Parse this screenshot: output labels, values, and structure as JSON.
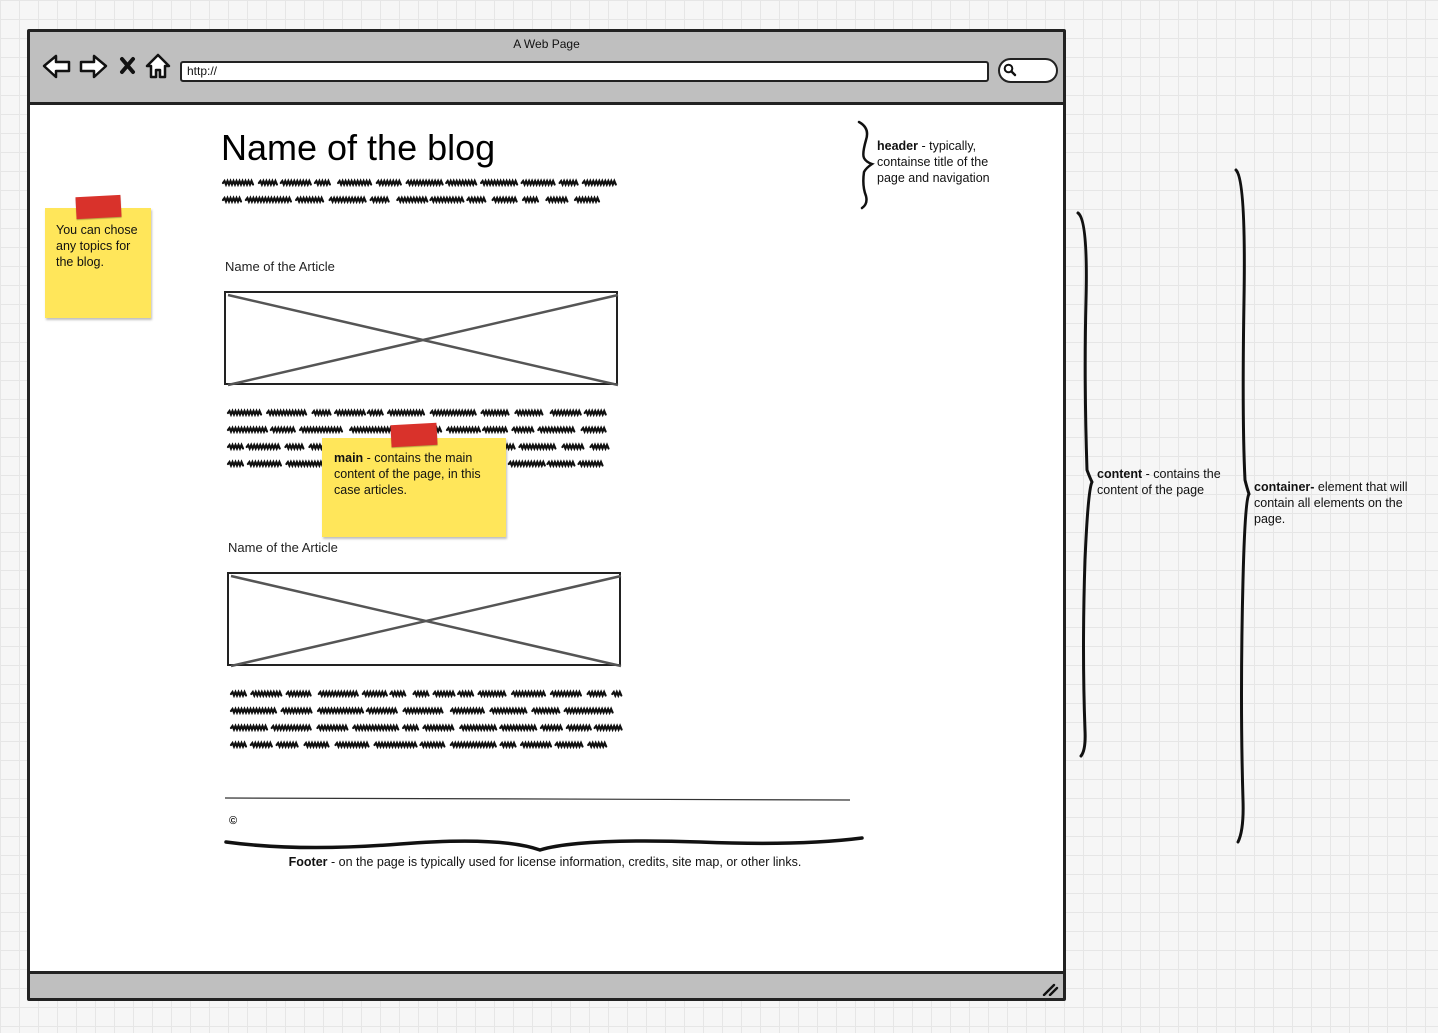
{
  "window": {
    "title": "A Web Page",
    "url": "http://"
  },
  "blog": {
    "title": "Name of the blog"
  },
  "articles": [
    {
      "title": "Name of the Article"
    },
    {
      "title": "Name of the Article"
    }
  ],
  "footer": {
    "copyright_symbol": "©"
  },
  "notes": {
    "topics": "You can chose any topics for the blog.",
    "main_term": "main",
    "main_text": " - contains the main content of the page, in this case articles."
  },
  "annotations": {
    "header_term": "header",
    "header_text": " - typically, containse title of the page and navigation",
    "content_term": "content",
    "content_text": " - contains the content of the page",
    "container_term": "container-",
    "container_text": "  element that will contain all elements on the page.",
    "footer_term": "Footer",
    "footer_text": " - on the page is typically used for license information, credits, site map, or other links."
  },
  "colors": {
    "chrome": "#bfbfbf",
    "sticky_note": "#ffe65a",
    "tape": "#d9322b",
    "ink": "#111111"
  },
  "icons": [
    "back-arrow-icon",
    "forward-arrow-icon",
    "stop-icon",
    "home-icon",
    "search-icon",
    "resize-grip-icon"
  ]
}
